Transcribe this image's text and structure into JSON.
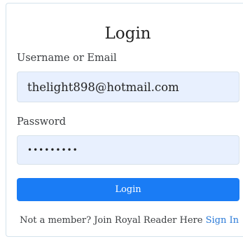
{
  "form": {
    "title": "Login",
    "username_label": "Username or Email",
    "username_value": "thelight898@hotmail.com",
    "password_label": "Password",
    "password_value": "•••••••••",
    "submit_label": "Login",
    "footer_text": "Not a member? Join Royal Reader Here",
    "signin_link": "Sign In"
  },
  "colors": {
    "accent": "#1a7cf5",
    "link": "#2a7ad8",
    "field_bg": "#e8f0fe"
  }
}
